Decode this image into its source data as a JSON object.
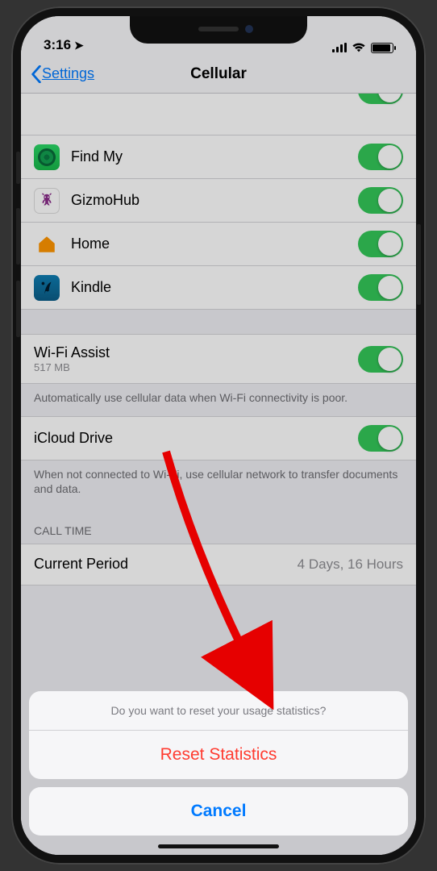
{
  "status": {
    "time": "3:16"
  },
  "nav": {
    "back": "Settings",
    "title": "Cellular"
  },
  "apps": [
    {
      "name": "Find My",
      "icon": "findmy"
    },
    {
      "name": "GizmoHub",
      "icon": "gizmo"
    },
    {
      "name": "Home",
      "icon": "home"
    },
    {
      "name": "Kindle",
      "icon": "kindle"
    }
  ],
  "wifi_assist": {
    "label": "Wi-Fi Assist",
    "sub": "517 MB",
    "footer": "Automatically use cellular data when Wi-Fi connectivity is poor."
  },
  "icloud_drive": {
    "label": "iCloud Drive",
    "footer": "When not connected to Wi-Fi, use cellular network to transfer documents and data."
  },
  "call_time": {
    "header": "Call Time",
    "current_label": "Current Period",
    "current_value": "4 Days, 16 Hours"
  },
  "sheet": {
    "message": "Do you want to reset your usage statistics?",
    "reset": "Reset Statistics",
    "cancel": "Cancel"
  }
}
